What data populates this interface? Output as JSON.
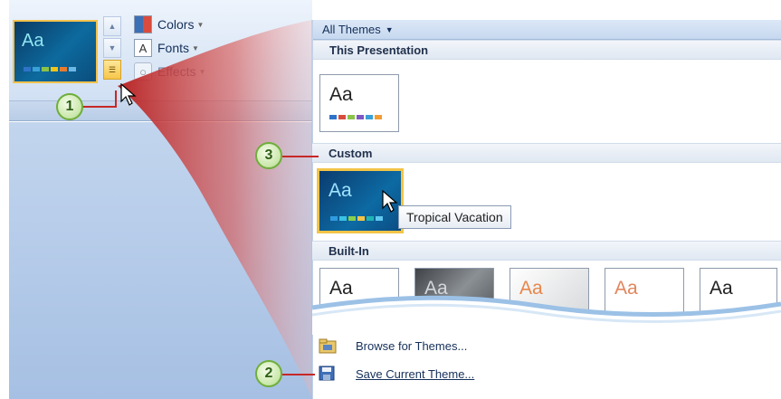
{
  "ribbon": {
    "theme_preview_text": "Aa",
    "menu": {
      "colors": "Colors",
      "fonts": "Fonts",
      "effects": "Effects"
    }
  },
  "gallery": {
    "header": "All Themes",
    "sections": {
      "this_presentation": "This Presentation",
      "custom": "Custom",
      "built_in": "Built-In"
    },
    "thumb_text": "Aa",
    "tooltip": "Tropical Vacation"
  },
  "footer": {
    "browse": "Browse for Themes...",
    "save": "Save Current Theme..."
  },
  "callouts": {
    "one": "1",
    "two": "2",
    "three": "3"
  },
  "colors": {
    "accent": "#f3c447",
    "callout_red": "#c62828",
    "badge_green": "#6fae3c"
  },
  "icons": [
    "scroll-up-icon",
    "scroll-down-icon",
    "more-icon",
    "colors-icon",
    "fonts-icon",
    "effects-icon",
    "dropdown-caret-icon",
    "mouse-cursor-icon",
    "folder-icon",
    "save-icon"
  ]
}
